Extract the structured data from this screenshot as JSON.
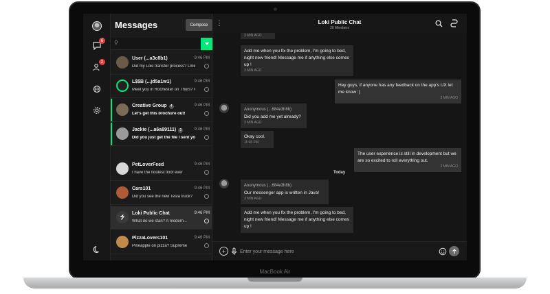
{
  "device": {
    "model": "MacBook Air"
  },
  "sidebar": {
    "messages_badge": "6",
    "contacts_badge": "2"
  },
  "list": {
    "title": "Messages",
    "compose_label": "Compose",
    "search_placeholder": "",
    "conversations": [
      {
        "name": "User (...a3c8b1)",
        "preview": "Did my Loki transfer process? Lmk",
        "time": "9:46 PM"
      },
      {
        "name": "L$$B (...jd5a1w1)",
        "preview": "Meet you in Rochester on Thurs? K",
        "time": "9:46 PM"
      },
      {
        "name": "Creative Group",
        "count": "4",
        "preview": "Let's get this brochure out!",
        "time": "9:46 PM"
      },
      {
        "name": "Jackie (...a6a89111)",
        "count": "2",
        "preview": "Did you just get the file I sent you?",
        "time": "9:46 PM"
      },
      {
        "name": "PetLoverFeed",
        "preview": "I have the floofest floof ever",
        "time": "9:46 PM"
      },
      {
        "name": "Cars101",
        "preview": "Did you see the new Tesla truck?",
        "time": "9:46 PM"
      },
      {
        "name": "Loki Public Chat",
        "preview": "What do we stan? A modern...",
        "time": "9:46 PM"
      },
      {
        "name": "PizzaLovers101",
        "preview": "Pineapple on pizza? Supreme",
        "time": "9:46 PM"
      }
    ]
  },
  "chat": {
    "title": "Loki Public Chat",
    "subtitle": "26 Members",
    "messages": [
      {
        "meta": "3 MIN AGO"
      },
      {
        "text": "Add me when you fix the problem, I'm going to bed, night new friend! Message me if anything else comes up !",
        "meta": "3 MIN AGO"
      },
      {
        "text": "Hey guys, if anyone has any feedback on the app's UX let me know :)",
        "meta": "3 MIN AGO"
      },
      {
        "sender": "Anonymous (...684e3h8b)",
        "text": "Did you add me yet already?",
        "meta": "3 MIN AGO"
      },
      {
        "text": "Okay cool.",
        "meta": "11:45 PM"
      },
      {
        "text": "The user experience is still in development but we are so excited to roll everything out.",
        "meta": "3 MIN AGO"
      },
      {
        "sender": "Anonymous (...684e3h8b)",
        "text": "Our messenger app is written in  Java!",
        "meta": "3 MIN AGO"
      },
      {
        "text": "Add me when you fix the problem, I'm going to bed, night new friend! Message me if anything else comes up !",
        "meta": ""
      }
    ],
    "day_separator": "Today",
    "input_placeholder": "Enter your message here"
  }
}
